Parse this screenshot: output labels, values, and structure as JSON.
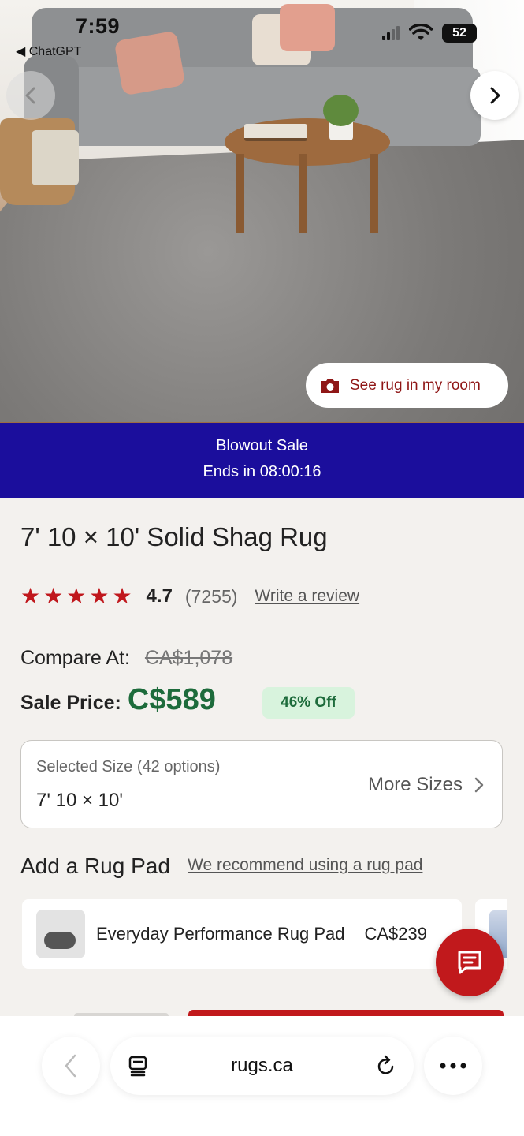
{
  "status_bar": {
    "time": "7:59",
    "back_app": "◀ ChatGPT",
    "battery": "52"
  },
  "hero": {
    "see_rug_label": "See rug in my room"
  },
  "sale_banner": {
    "title": "Blowout Sale",
    "ends": "Ends in 08:00:16"
  },
  "product": {
    "title": "7' 10 × 10' Solid Shag Rug",
    "rating": "4.7",
    "rating_count": "(7255)",
    "stars": 5,
    "write_review": "Write a review",
    "compare_label": "Compare At:",
    "compare_price": "CA$1,078",
    "sale_label": "Sale Price:",
    "sale_price": "C$589",
    "discount": "46% Off"
  },
  "size": {
    "label": "Selected Size (42 options)",
    "value": "7' 10 × 10'",
    "more_sizes": "More Sizes"
  },
  "rug_pad": {
    "heading": "Add a Rug Pad",
    "recommend_link": "We recommend using a rug pad",
    "items": [
      {
        "name": "Everyday Performance Rug Pad",
        "price": "CA$239"
      }
    ]
  },
  "browser": {
    "url": "rugs.ca"
  },
  "colors": {
    "banner": "#1b0e9c",
    "accent_red": "#c1191c",
    "sale_green": "#1d6b3b"
  }
}
